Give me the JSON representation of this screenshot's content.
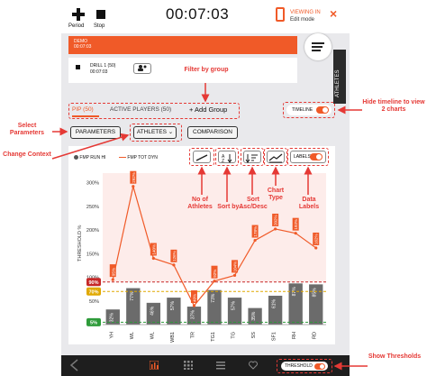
{
  "header": {
    "period_label": "Period",
    "stop_label": "Stop",
    "timer": "00:07:03",
    "viewing_line1": "VIEWING IN",
    "viewing_line2": "Edit mode",
    "close": "×"
  },
  "session": {
    "demo_label": "DEMO",
    "demo_time": "00:07:03",
    "drill_name": "DRILL 1 (50)",
    "drill_time": "00:07:03"
  },
  "sidebar_tab": "ATHLETES",
  "tabs": [
    {
      "label": "PIP (50)"
    },
    {
      "label": "ACTIVE PLAYERS (50)"
    },
    {
      "label": "+ Add Group"
    }
  ],
  "timeline_label": "TIMELINE",
  "buttons": {
    "parameters": "PARAMETERS",
    "athletes": "ATHLETES",
    "comparison": "COMPARISON"
  },
  "legend": {
    "series1": "FMP RUN HI",
    "series2": "FMP TOT DYN"
  },
  "labels_toggle": "LABELS",
  "threshold_toggle": "THRESHOLD",
  "annotations": {
    "filter_by_group": "Filter by group",
    "hide_timeline": "Hide timeline to view 2 charts",
    "select_parameters": "Select Parameters",
    "change_context": "Change Context",
    "no_of_athletes": "No of Athletes",
    "sort_by": "Sort by...",
    "sort_asc_desc": "Sort Asc/Desc",
    "chart_type": "Chart Type",
    "data_labels": "Data Labels",
    "show_thresholds": "Show Thresholds"
  },
  "colors": {
    "accent": "#f05a28",
    "annotation": "#e53935",
    "bar": "#6b6b6b",
    "line": "#f05a28",
    "threshold_red": "#c62828",
    "threshold_yellow": "#e0a800",
    "threshold_green": "#2e9b3a"
  },
  "chart_data": {
    "type": "bar",
    "ylabel": "THRESHOLD %",
    "yticks": [
      "300%",
      "250%",
      "200%",
      "150%",
      "100%",
      "50%"
    ],
    "ylim": [
      0,
      320
    ],
    "categories": [
      "YH",
      "WL",
      "WL",
      "WB1",
      "TR",
      "TG1",
      "TG",
      "SS",
      "SF1",
      "RH",
      "RD"
    ],
    "thresholds": [
      {
        "label": "90%",
        "value": 90,
        "color": "#c62828"
      },
      {
        "label": "70%",
        "value": 70,
        "color": "#e0a800"
      },
      {
        "label": "5%",
        "value": 5,
        "color": "#2e9b3a"
      }
    ],
    "series": [
      {
        "name": "FMP RUN HI",
        "values": [
          32,
          77,
          46,
          57,
          38,
          73,
          57,
          35,
          61,
          87,
          85
        ],
        "labels": [
          "32%",
          "77%",
          "46%",
          "57%",
          "37%",
          "73%",
          "57%",
          "35%",
          "61%",
          "87%",
          "85%"
        ]
      },
      {
        "name": "FMP TOT DYN",
        "values": [
          95,
          292,
          140,
          126,
          40,
          92,
          104,
          178,
          202,
          193,
          162
        ],
        "labels": [
          "95%",
          "292%",
          "140%",
          "126%",
          "40%",
          "92%",
          "104%",
          "178%",
          "202%",
          "193%",
          "162%"
        ]
      }
    ]
  }
}
